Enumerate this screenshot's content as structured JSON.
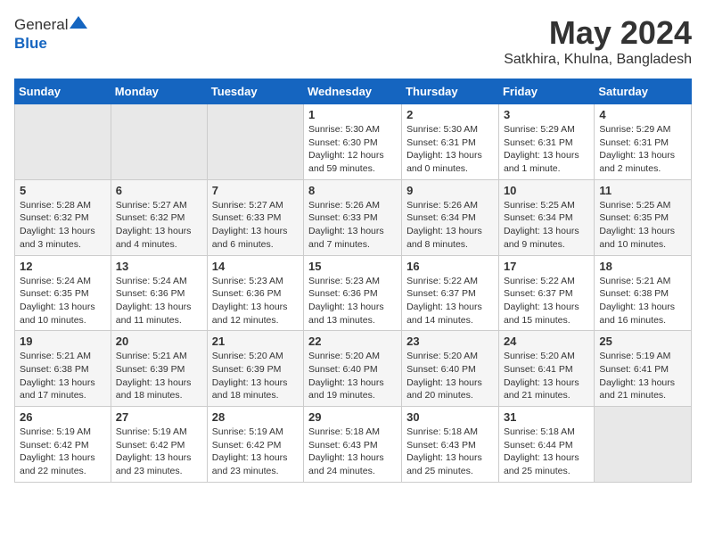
{
  "logo": {
    "general": "General",
    "blue": "Blue"
  },
  "title": "May 2024",
  "subtitle": "Satkhira, Khulna, Bangladesh",
  "weekdays": [
    "Sunday",
    "Monday",
    "Tuesday",
    "Wednesday",
    "Thursday",
    "Friday",
    "Saturday"
  ],
  "weeks": [
    [
      {
        "day": "",
        "content": ""
      },
      {
        "day": "",
        "content": ""
      },
      {
        "day": "",
        "content": ""
      },
      {
        "day": "1",
        "content": "Sunrise: 5:30 AM\nSunset: 6:30 PM\nDaylight: 12 hours\nand 59 minutes."
      },
      {
        "day": "2",
        "content": "Sunrise: 5:30 AM\nSunset: 6:31 PM\nDaylight: 13 hours\nand 0 minutes."
      },
      {
        "day": "3",
        "content": "Sunrise: 5:29 AM\nSunset: 6:31 PM\nDaylight: 13 hours\nand 1 minute."
      },
      {
        "day": "4",
        "content": "Sunrise: 5:29 AM\nSunset: 6:31 PM\nDaylight: 13 hours\nand 2 minutes."
      }
    ],
    [
      {
        "day": "5",
        "content": "Sunrise: 5:28 AM\nSunset: 6:32 PM\nDaylight: 13 hours\nand 3 minutes."
      },
      {
        "day": "6",
        "content": "Sunrise: 5:27 AM\nSunset: 6:32 PM\nDaylight: 13 hours\nand 4 minutes."
      },
      {
        "day": "7",
        "content": "Sunrise: 5:27 AM\nSunset: 6:33 PM\nDaylight: 13 hours\nand 6 minutes."
      },
      {
        "day": "8",
        "content": "Sunrise: 5:26 AM\nSunset: 6:33 PM\nDaylight: 13 hours\nand 7 minutes."
      },
      {
        "day": "9",
        "content": "Sunrise: 5:26 AM\nSunset: 6:34 PM\nDaylight: 13 hours\nand 8 minutes."
      },
      {
        "day": "10",
        "content": "Sunrise: 5:25 AM\nSunset: 6:34 PM\nDaylight: 13 hours\nand 9 minutes."
      },
      {
        "day": "11",
        "content": "Sunrise: 5:25 AM\nSunset: 6:35 PM\nDaylight: 13 hours\nand 10 minutes."
      }
    ],
    [
      {
        "day": "12",
        "content": "Sunrise: 5:24 AM\nSunset: 6:35 PM\nDaylight: 13 hours\nand 10 minutes."
      },
      {
        "day": "13",
        "content": "Sunrise: 5:24 AM\nSunset: 6:36 PM\nDaylight: 13 hours\nand 11 minutes."
      },
      {
        "day": "14",
        "content": "Sunrise: 5:23 AM\nSunset: 6:36 PM\nDaylight: 13 hours\nand 12 minutes."
      },
      {
        "day": "15",
        "content": "Sunrise: 5:23 AM\nSunset: 6:36 PM\nDaylight: 13 hours\nand 13 minutes."
      },
      {
        "day": "16",
        "content": "Sunrise: 5:22 AM\nSunset: 6:37 PM\nDaylight: 13 hours\nand 14 minutes."
      },
      {
        "day": "17",
        "content": "Sunrise: 5:22 AM\nSunset: 6:37 PM\nDaylight: 13 hours\nand 15 minutes."
      },
      {
        "day": "18",
        "content": "Sunrise: 5:21 AM\nSunset: 6:38 PM\nDaylight: 13 hours\nand 16 minutes."
      }
    ],
    [
      {
        "day": "19",
        "content": "Sunrise: 5:21 AM\nSunset: 6:38 PM\nDaylight: 13 hours\nand 17 minutes."
      },
      {
        "day": "20",
        "content": "Sunrise: 5:21 AM\nSunset: 6:39 PM\nDaylight: 13 hours\nand 18 minutes."
      },
      {
        "day": "21",
        "content": "Sunrise: 5:20 AM\nSunset: 6:39 PM\nDaylight: 13 hours\nand 18 minutes."
      },
      {
        "day": "22",
        "content": "Sunrise: 5:20 AM\nSunset: 6:40 PM\nDaylight: 13 hours\nand 19 minutes."
      },
      {
        "day": "23",
        "content": "Sunrise: 5:20 AM\nSunset: 6:40 PM\nDaylight: 13 hours\nand 20 minutes."
      },
      {
        "day": "24",
        "content": "Sunrise: 5:20 AM\nSunset: 6:41 PM\nDaylight: 13 hours\nand 21 minutes."
      },
      {
        "day": "25",
        "content": "Sunrise: 5:19 AM\nSunset: 6:41 PM\nDaylight: 13 hours\nand 21 minutes."
      }
    ],
    [
      {
        "day": "26",
        "content": "Sunrise: 5:19 AM\nSunset: 6:42 PM\nDaylight: 13 hours\nand 22 minutes."
      },
      {
        "day": "27",
        "content": "Sunrise: 5:19 AM\nSunset: 6:42 PM\nDaylight: 13 hours\nand 23 minutes."
      },
      {
        "day": "28",
        "content": "Sunrise: 5:19 AM\nSunset: 6:42 PM\nDaylight: 13 hours\nand 23 minutes."
      },
      {
        "day": "29",
        "content": "Sunrise: 5:18 AM\nSunset: 6:43 PM\nDaylight: 13 hours\nand 24 minutes."
      },
      {
        "day": "30",
        "content": "Sunrise: 5:18 AM\nSunset: 6:43 PM\nDaylight: 13 hours\nand 25 minutes."
      },
      {
        "day": "31",
        "content": "Sunrise: 5:18 AM\nSunset: 6:44 PM\nDaylight: 13 hours\nand 25 minutes."
      },
      {
        "day": "",
        "content": ""
      }
    ]
  ]
}
